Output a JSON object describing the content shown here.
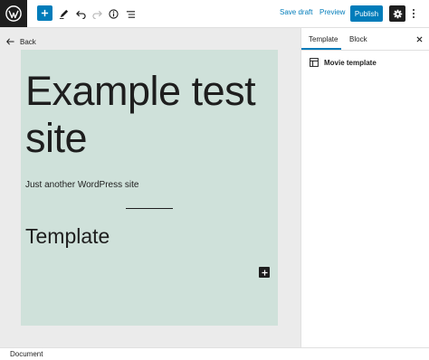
{
  "toolbar": {
    "save_draft_label": "Save draft",
    "preview_label": "Preview",
    "publish_label": "Publish"
  },
  "editor": {
    "back_label": "Back",
    "site_title": "Example test site",
    "site_tagline": "Just another WordPress site",
    "template_heading": "Template"
  },
  "sidebar": {
    "tabs": [
      {
        "label": "Template",
        "active": true
      },
      {
        "label": "Block",
        "active": false
      }
    ],
    "template_name": "Movie template"
  },
  "footer": {
    "breadcrumb": "Document"
  },
  "colors": {
    "accent": "#007cba",
    "canvas_bg": "#cfe1da",
    "editor_bg": "#ebebeb",
    "dark": "#1e1e1e"
  },
  "icons": [
    "wordpress-logo",
    "plus-icon",
    "pencil-icon",
    "undo-icon",
    "redo-icon",
    "info-icon",
    "list-view-icon",
    "gear-icon",
    "more-vertical-icon",
    "back-arrow-icon",
    "close-icon",
    "layout-icon"
  ]
}
